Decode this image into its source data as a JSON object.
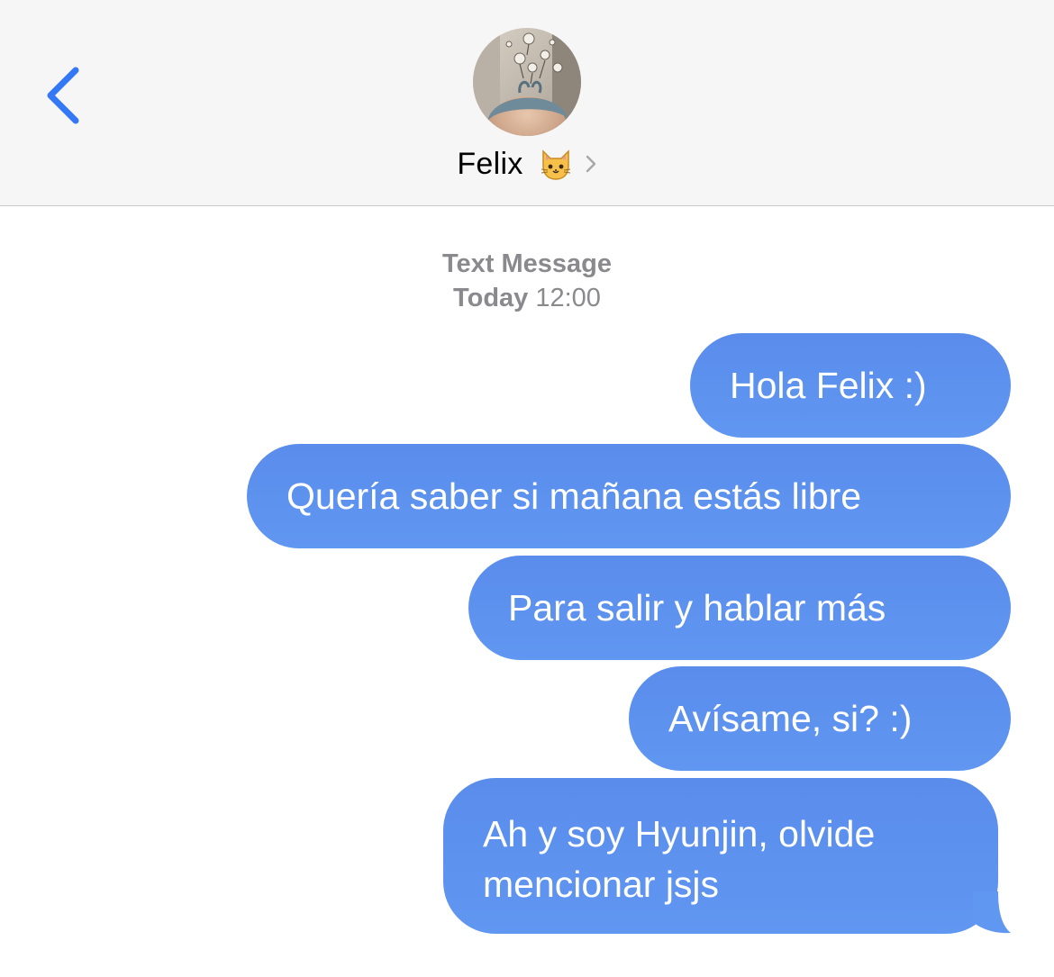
{
  "header": {
    "contact_name": "Felix",
    "contact_emoji": "🐱"
  },
  "conversation": {
    "service_label": "Text Message",
    "timestamp_day": "Today",
    "timestamp_time": "12:00"
  },
  "messages": [
    {
      "text": "Hola Felix :)",
      "direction": "outgoing"
    },
    {
      "text": "Quería saber si mañana estás libre",
      "direction": "outgoing"
    },
    {
      "text": "Para salir y hablar más",
      "direction": "outgoing"
    },
    {
      "text": "Avísame, si? :)",
      "direction": "outgoing"
    },
    {
      "text": "Ah y soy Hyunjin, olvide mencionar jsjs",
      "direction": "outgoing"
    }
  ],
  "colors": {
    "accent": "#3478f6",
    "bubble": "#5d91ee",
    "meta_text": "#8a8a8e",
    "header_bg": "#f6f6f6"
  },
  "icons": {
    "back": "chevron-left-icon",
    "details": "chevron-right-icon",
    "emoji": "cat-face-icon"
  }
}
